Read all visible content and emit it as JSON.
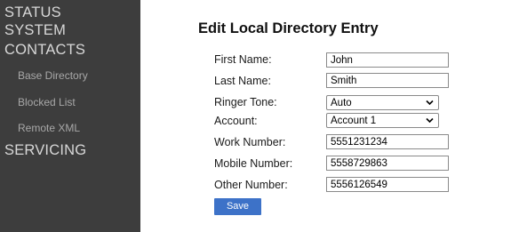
{
  "sidebar": {
    "items": [
      {
        "label": "STATUS"
      },
      {
        "label": "SYSTEM"
      },
      {
        "label": "CONTACTS"
      },
      {
        "label": "Base Directory"
      },
      {
        "label": "Blocked List"
      },
      {
        "label": "Remote XML"
      },
      {
        "label": "SERVICING"
      }
    ]
  },
  "form": {
    "title": "Edit Local Directory Entry",
    "first_name": {
      "label": "First Name:",
      "value": "John"
    },
    "last_name": {
      "label": "Last Name:",
      "value": "Smith"
    },
    "ringer_tone": {
      "label": "Ringer Tone:",
      "value": "Auto"
    },
    "account": {
      "label": "Account:",
      "value": "Account 1"
    },
    "work_number": {
      "label": "Work Number:",
      "value": "5551231234"
    },
    "mobile_number": {
      "label": "Mobile Number:",
      "value": "5558729863"
    },
    "other_number": {
      "label": "Other Number:",
      "value": "5556126549"
    },
    "save_label": "Save"
  }
}
